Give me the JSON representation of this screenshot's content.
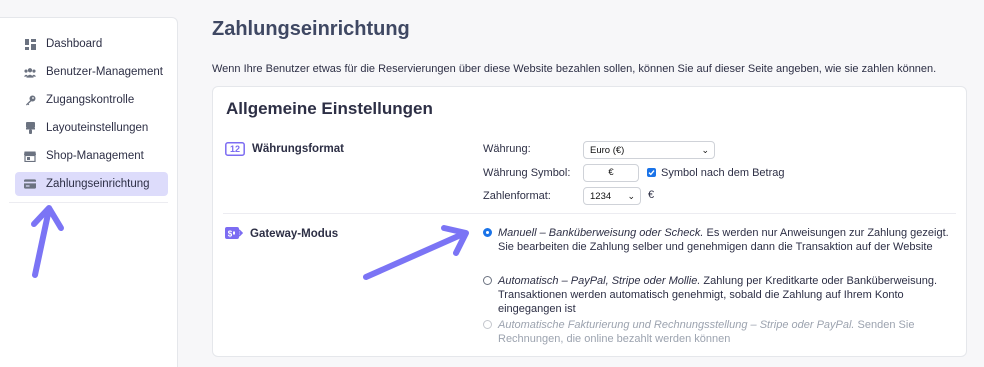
{
  "sidebar": {
    "items": [
      {
        "label": "Dashboard",
        "icon": "dashboard-icon",
        "active": false
      },
      {
        "label": "Benutzer-Management",
        "icon": "users-icon",
        "active": false
      },
      {
        "label": "Zugangskontrolle",
        "icon": "key-icon",
        "active": false
      },
      {
        "label": "Layouteinstellungen",
        "icon": "brush-icon",
        "active": false
      },
      {
        "label": "Shop-Management",
        "icon": "store-icon",
        "active": false
      },
      {
        "label": "Zahlungseinrichtung",
        "icon": "credit-card-icon",
        "active": true
      }
    ]
  },
  "page": {
    "title": "Zahlungseinrichtung",
    "description": "Wenn Ihre Benutzer etwas für die Reservierungen über diese Website bezahlen sollen, können Sie auf dieser Seite angeben, wie sie zahlen können."
  },
  "general": {
    "title": "Allgemeine Einstellungen",
    "currency_format": {
      "heading": "Währungsformat",
      "icon_text": "12",
      "currency_label": "Währung:",
      "currency_value": "Euro (€)",
      "symbol_label": "Währung Symbol:",
      "symbol_value": "€",
      "symbol_after_label": "Symbol nach dem Betrag",
      "symbol_after_checked": true,
      "number_format_label": "Zahlenformat:",
      "number_format_value": "1234",
      "number_format_suffix": "€"
    },
    "gateway": {
      "heading": "Gateway-Modus",
      "options": [
        {
          "title": "Manuell – Banküberweisung oder Scheck.",
          "text": " Es werden nur Anweisungen zur Zahlung gezeigt. Sie bearbeiten die Zahlung selber und genehmigen dann die Transaktion auf der Website",
          "checked": true,
          "disabled": false
        },
        {
          "title": "Automatisch – PayPal, Stripe oder Mollie.",
          "text": " Zahlung per Kreditkarte oder Banküberweisung. Transaktionen werden automatisch genehmigt, sobald die Zahlung auf Ihrem Konto eingegangen ist",
          "checked": false,
          "disabled": false
        },
        {
          "title": "Automatische Fakturierung und Rechnungsstellung – Stripe oder PayPal.",
          "text": " Senden Sie Rechnungen, die online bezahlt werden können",
          "checked": false,
          "disabled": true
        }
      ]
    }
  },
  "colors": {
    "accent": "#7c6cf2",
    "checkbox": "#1a73e8",
    "active_nav": "#dddcfb",
    "annotation_arrow": "#7b74f5"
  }
}
